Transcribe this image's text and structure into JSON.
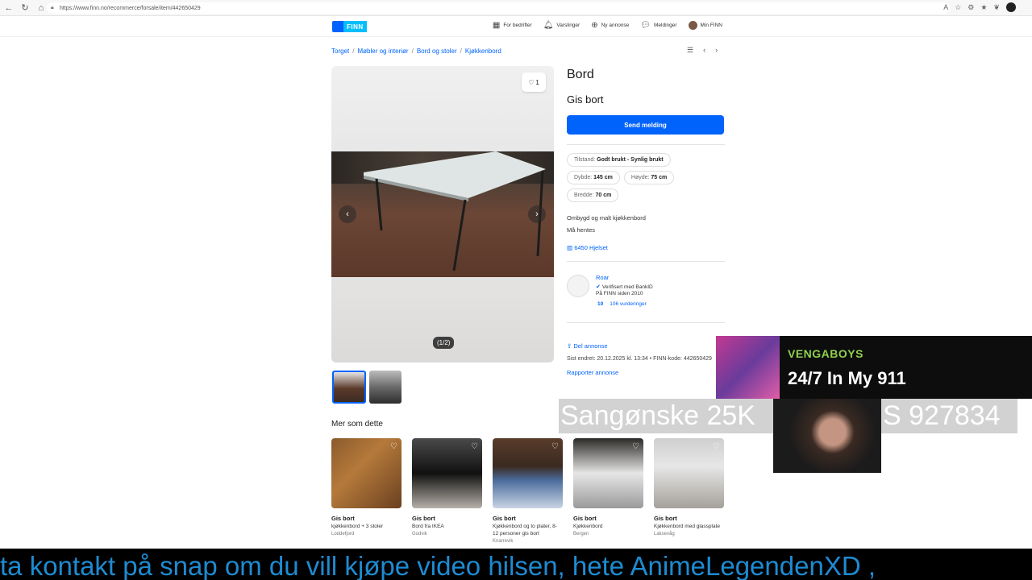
{
  "browser": {
    "url": "https://www.finn.no/recommerce/forsale/item/442650429"
  },
  "header": {
    "logo_text": "FINN",
    "nav": [
      {
        "label": "For bedrifter",
        "icon": "building-icon"
      },
      {
        "label": "Varslinger",
        "icon": "bell-icon"
      },
      {
        "label": "Ny annonse",
        "icon": "plus-circle-icon"
      },
      {
        "label": "Meldinger",
        "icon": "chat-icon"
      },
      {
        "label": "Min FINN",
        "icon": "avatar"
      }
    ]
  },
  "breadcrumb": [
    "Torget",
    "Møbler og interiør",
    "Bord og stoler",
    "Kjøkkenbord"
  ],
  "gallery": {
    "favorite_count": "1",
    "counter": "(1/2)"
  },
  "listing": {
    "title": "Bord",
    "price": "Gis bort",
    "send_button": "Send melding",
    "attributes": [
      {
        "label": "Tilstand:",
        "value": "Godt brukt - Synlig brukt"
      },
      {
        "label": "Dybde:",
        "value": "145 cm"
      },
      {
        "label": "Høyde:",
        "value": "75 cm"
      },
      {
        "label": "Bredde:",
        "value": "70 cm"
      }
    ],
    "description": [
      "Ombygd og malt kjøkkenbord",
      "Må hentes"
    ],
    "location": "6450 Hjelset"
  },
  "seller": {
    "name": "Roar",
    "verified": "Verifisert med BankID",
    "since": "På FINN siden 2010",
    "score": "10",
    "reviews": "106 vurderinger"
  },
  "meta": {
    "share": "Del annonse",
    "last_changed": "Sist endret: 20.12.2025 kl. 13:34 • FINN-kode: 442650429",
    "report": "Rapporter annonse"
  },
  "more": {
    "title": "Mer som dette",
    "cards": [
      {
        "price": "Gis bort",
        "desc": "kjøkkenbord + 3 stoler",
        "loc": "Loddefjord"
      },
      {
        "price": "Gis bort",
        "desc": "Bord fra IKEA",
        "loc": "Godvik"
      },
      {
        "price": "Gis bort",
        "desc": "Kjøkkenbord og to plater, 8-12 personer gis bort",
        "loc": "Knarrevik"
      },
      {
        "price": "Gis bort",
        "desc": "Kjøkkenbord",
        "loc": "Bergen"
      },
      {
        "price": "Gis bort",
        "desc": "Kjøkkenbord med glassplate",
        "loc": "Laksevåg"
      }
    ]
  },
  "stream": {
    "artist": "VENGABOYS",
    "song": "24/7 In My 911",
    "tts": "Sangønske 25K",
    "tts_tail": "S 927834",
    "ticker": "ta kontakt  på snap om du vill kjøpe video  hilsen, hete AnimeLegendenXD ,"
  }
}
